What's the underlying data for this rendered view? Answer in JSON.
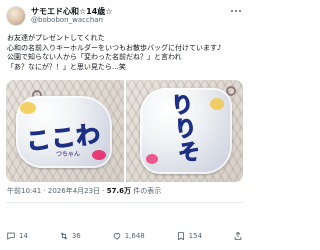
{
  "author": {
    "display_name": "サモエド心和☆14歳☆",
    "handle": "@bobobon_wacchan"
  },
  "body_lines": [
    "お友達がプレゼントしてくれた",
    "心和の名前入りキーホルダーをいつもお散歩バッグに付けています♪",
    "公園で知らない人から「変わった名前だね？」と言われ",
    "「あ？なにが？！」と思い見たら…笑"
  ],
  "media": {
    "left_charm_text": "ここわ",
    "left_charm_subtext": "つちゃん",
    "right_charm_text": "りりそ"
  },
  "meta": {
    "time": "午前10:41",
    "date": "2026年4月23日",
    "views": "57.6万",
    "views_label": "件の表示"
  },
  "actions": {
    "replies": "14",
    "reposts": "36",
    "likes": "1,648",
    "bookmarks": "154"
  }
}
